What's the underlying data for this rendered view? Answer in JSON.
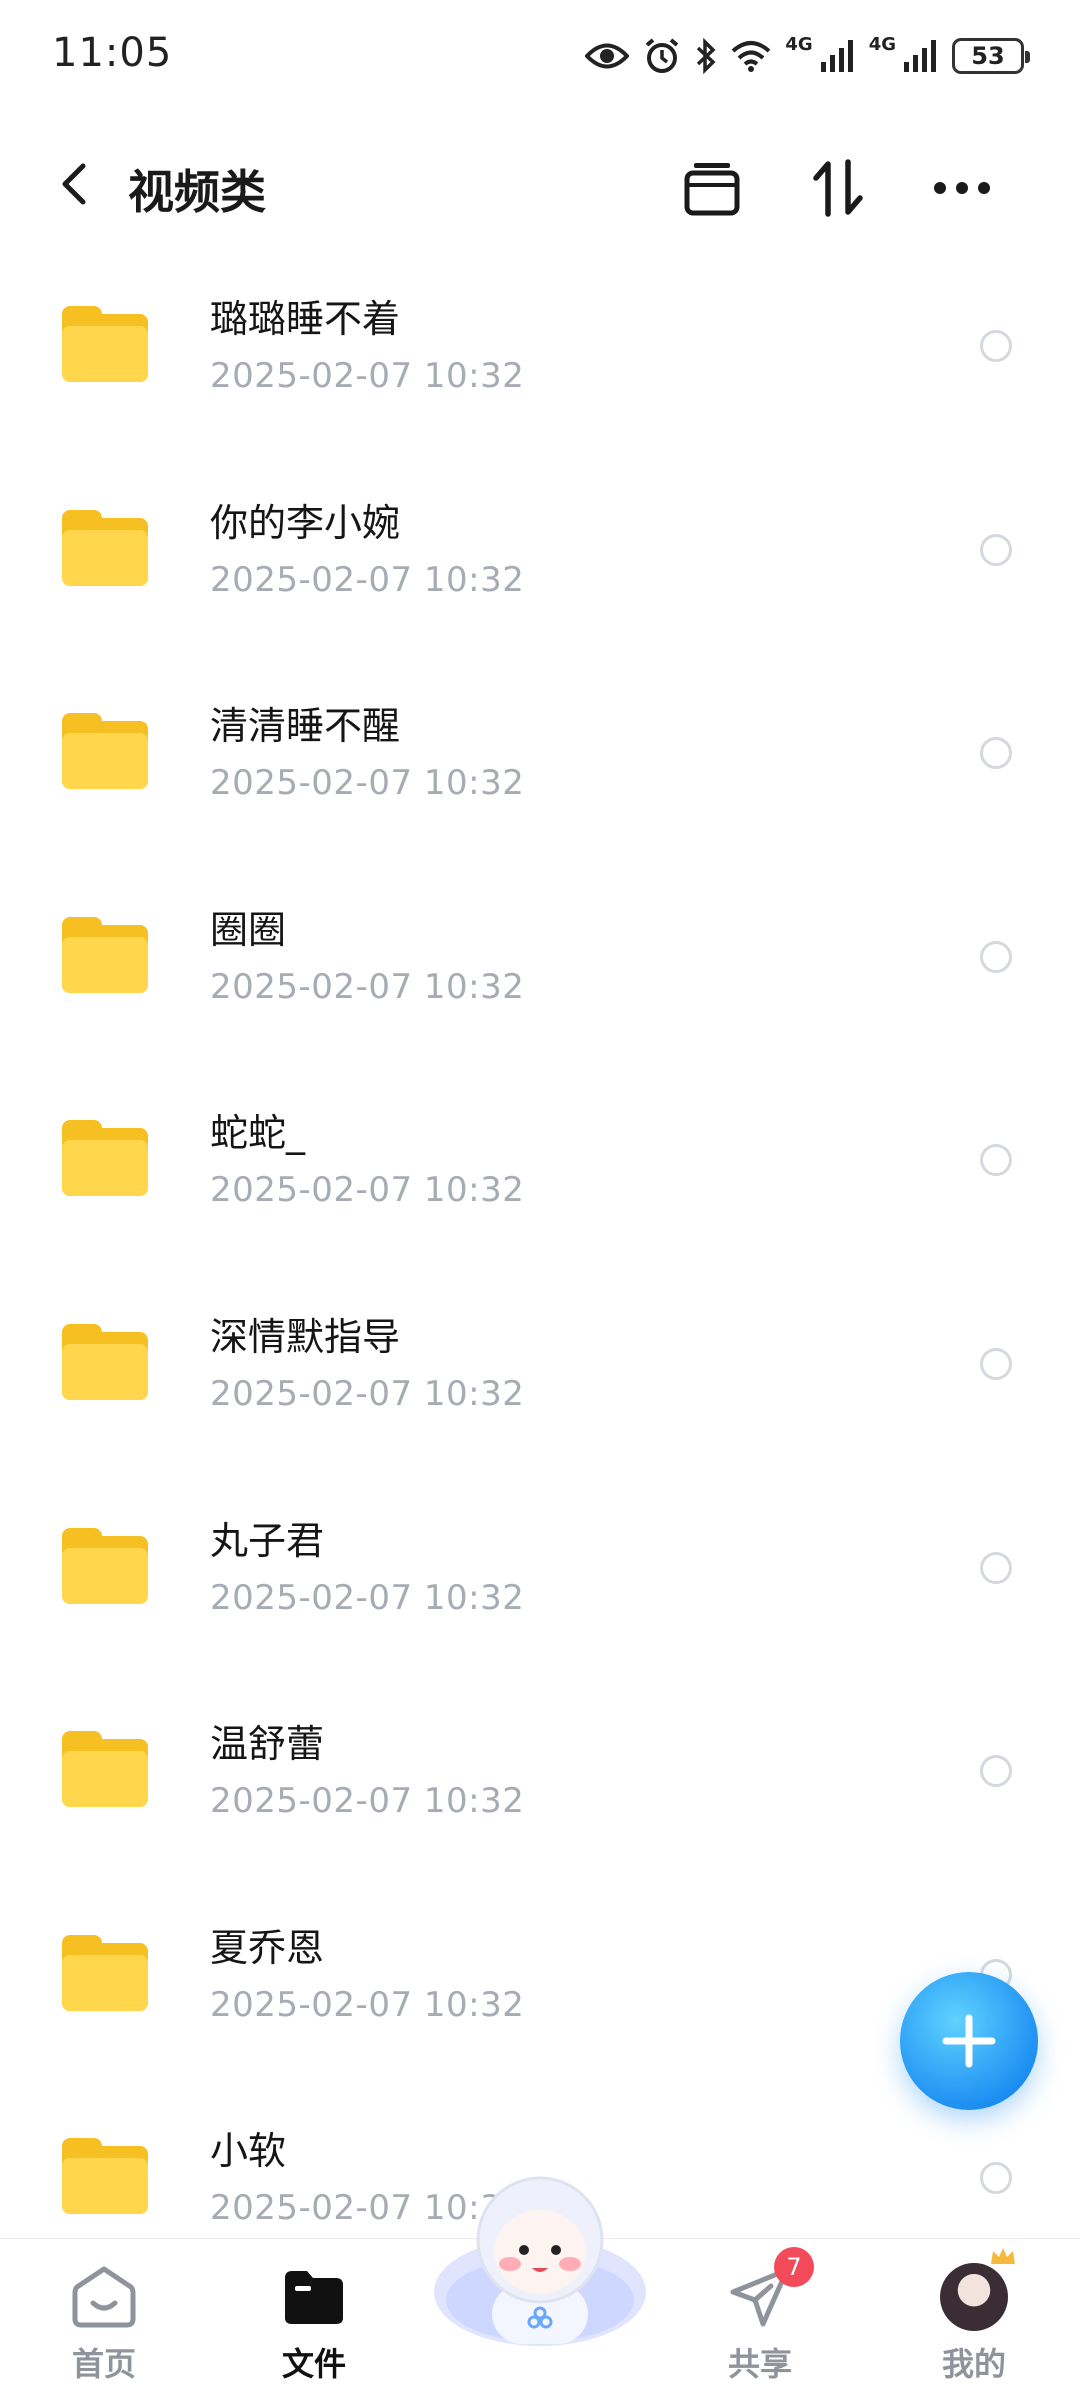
{
  "status_bar": {
    "time": "11:05",
    "network_1": "4G",
    "network_2": "4G",
    "battery": "53"
  },
  "header": {
    "title": "视频类"
  },
  "files": [
    {
      "name": "璐璐睡不着",
      "date": "2025-02-07  10:32"
    },
    {
      "name": "你的李小婉",
      "date": "2025-02-07  10:32"
    },
    {
      "name": "清清睡不醒",
      "date": "2025-02-07  10:32"
    },
    {
      "name": "圈圈",
      "date": "2025-02-07  10:32"
    },
    {
      "name": "蛇蛇_",
      "date": "2025-02-07  10:32"
    },
    {
      "name": "深情默指导",
      "date": "2025-02-07  10:32"
    },
    {
      "name": "丸子君",
      "date": "2025-02-07  10:32"
    },
    {
      "name": "温舒蕾",
      "date": "2025-02-07  10:32"
    },
    {
      "name": "夏乔恩",
      "date": "2025-02-07  10:32"
    },
    {
      "name": "小软",
      "date": "2025-02-07  10:32"
    }
  ],
  "bottom_nav": {
    "home": "首页",
    "files": "文件",
    "share": "共享",
    "share_badge": "7",
    "mine": "我的"
  },
  "colors": {
    "folder": "#ffd64c",
    "fab": "#1a8cf2",
    "badge": "#f34a5a"
  }
}
